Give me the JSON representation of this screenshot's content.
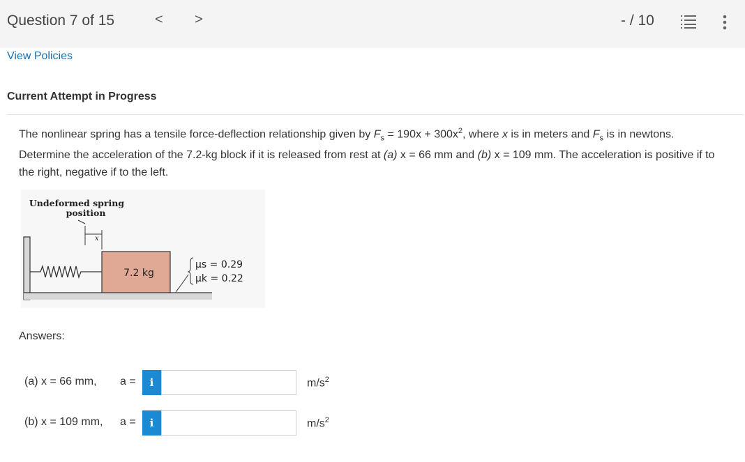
{
  "header": {
    "question_title": "Question 7 of 15",
    "prev_label": "<",
    "next_label": ">",
    "score": "- / 10",
    "list_icon": "question-list-icon",
    "more_icon": "more-vertical-icon"
  },
  "links": {
    "view_policies": "View Policies"
  },
  "attempt_heading": "Current Attempt in Progress",
  "problem": {
    "p1": "The nonlinear spring has a tensile force-deflection relationship given by ",
    "fs": "F",
    "fs_sub": "s",
    "eq": " = 190x + 300x",
    "eq_sup": "2",
    "p2": ", where ",
    "x": "x",
    "p3": " is in meters and ",
    "fs2": "F",
    "fs2_sub": "s",
    "p4": " is in newtons. Determine the acceleration of the 7.2-kg block if it is released from rest at ",
    "a_label": "(a)",
    "p5": " x = 66 mm and ",
    "b_label": "(b)",
    "p6": " x = 109 mm. The acceleration is positive if to the right, negative if to the left."
  },
  "figure": {
    "caption_line1": "Undeformed spring",
    "caption_line2": "position",
    "x_label": "x",
    "block_label": "7.2 kg",
    "mu_s": "μs = 0.29",
    "mu_k": "μk = 0.22"
  },
  "answers": {
    "label": "Answers:",
    "rows": [
      {
        "label": "(a) x = 66  mm,",
        "a_eq": "a =",
        "info": "i",
        "value": "",
        "unit": "m/s",
        "unit_sup": "2"
      },
      {
        "label": "(b) x = 109  mm,",
        "a_eq": "a =",
        "info": "i",
        "value": "",
        "unit": "m/s",
        "unit_sup": "2"
      }
    ]
  },
  "colors": {
    "topbar_bg": "#f4f4f4",
    "link": "#1a6fb0",
    "info_button": "#1a8ad4",
    "block_fill": "#e0a995"
  }
}
